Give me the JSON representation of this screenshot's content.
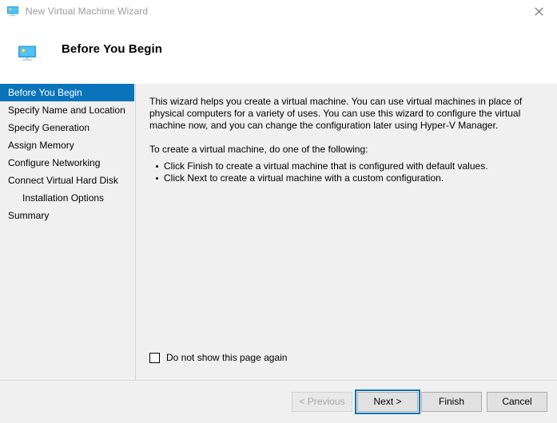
{
  "window": {
    "title": "New Virtual Machine Wizard",
    "title_icon": "virtual-machine-monitor-icon",
    "close_icon": "close-icon",
    "title_text_color": "#9b9b9b"
  },
  "header": {
    "title": "Before You Begin",
    "icon": "virtual-machine-monitor-icon"
  },
  "sidebar": {
    "accent_color": "#0a73ba",
    "items": [
      {
        "label": "Before You Begin",
        "active": true,
        "indent": false
      },
      {
        "label": "Specify Name and Location",
        "active": false,
        "indent": false
      },
      {
        "label": "Specify Generation",
        "active": false,
        "indent": false
      },
      {
        "label": "Assign Memory",
        "active": false,
        "indent": false
      },
      {
        "label": "Configure Networking",
        "active": false,
        "indent": false
      },
      {
        "label": "Connect Virtual Hard Disk",
        "active": false,
        "indent": false
      },
      {
        "label": "Installation Options",
        "active": false,
        "indent": true
      },
      {
        "label": "Summary",
        "active": false,
        "indent": false
      }
    ]
  },
  "content": {
    "paragraph1": "This wizard helps you create a virtual machine. You can use virtual machines in place of physical computers for a variety of uses. You can use this wizard to configure the virtual machine now, and you can change the configuration later using Hyper-V Manager.",
    "paragraph2": "To create a virtual machine, do one of the following:",
    "bullets": [
      "Click Finish to create a virtual machine that is configured with default values.",
      "Click Next to create a virtual machine with a custom configuration."
    ],
    "checkbox": {
      "label": "Do not show this page again",
      "checked": false
    }
  },
  "footer": {
    "buttons": [
      {
        "label": "< Previous",
        "state": "disabled"
      },
      {
        "label": "Next >",
        "state": "focused"
      },
      {
        "label": "Finish",
        "state": "normal"
      },
      {
        "label": "Cancel",
        "state": "normal"
      }
    ]
  }
}
